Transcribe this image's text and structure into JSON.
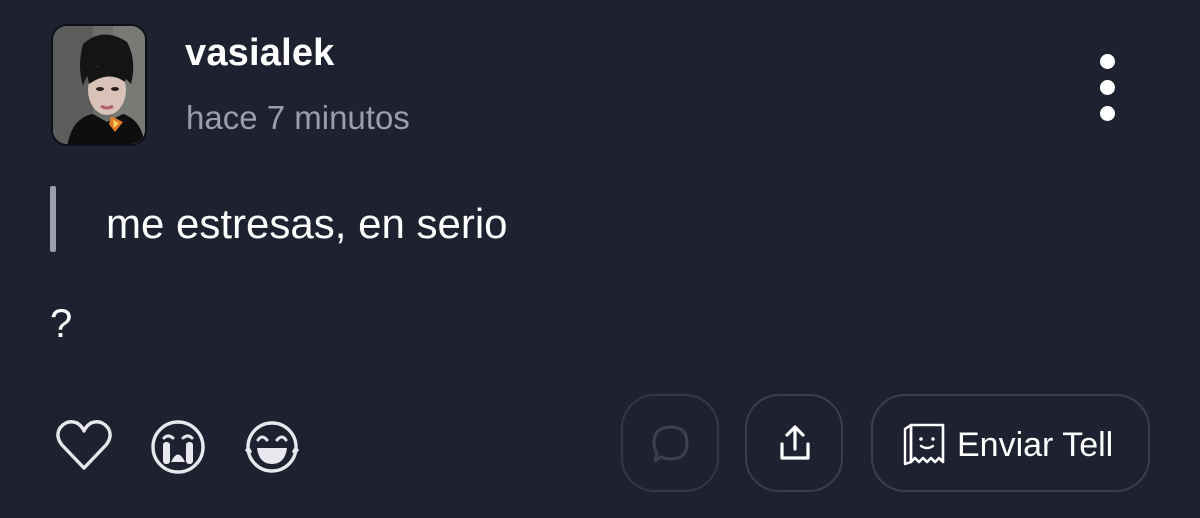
{
  "post": {
    "username": "vasialek",
    "timestamp": "hace 7 minutos",
    "avatar_icon": "user-photo-avatar",
    "question": "me estresas, en serio",
    "answer": "?"
  },
  "menu": {
    "icon": "more-vertical-icon"
  },
  "reactions": [
    {
      "icon": "heart-outline-icon"
    },
    {
      "icon": "crying-face-icon"
    },
    {
      "icon": "laughing-tears-face-icon"
    }
  ],
  "actions": {
    "comment_icon": "comment-bubble-icon",
    "share_icon": "share-upload-icon",
    "send_icon": "tell-paper-icon",
    "send_label": "Enviar Tell"
  },
  "colors": {
    "background": "#1e2230",
    "text": "#ffffff",
    "muted": "#9a9eaa",
    "pill_border": "#3a3f4f"
  }
}
